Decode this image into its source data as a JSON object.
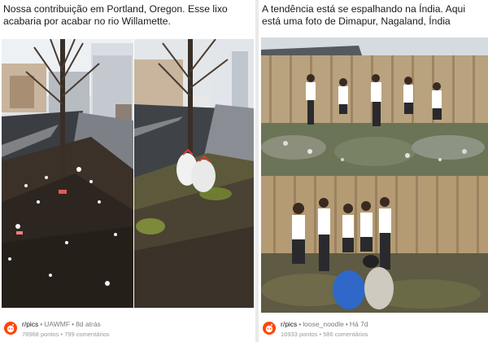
{
  "posts": [
    {
      "caption": "Nossa contribuição em Portland, Oregon. Esse lixo acabaria por acabar no rio Willamette.",
      "subreddit": "r/pics",
      "author": "UAWMF",
      "time": "8d atrás",
      "points": "78968 pontos",
      "comments": "799 comentários"
    },
    {
      "caption": "A tendência está se espalhando na Índia. Aqui está uma foto de Dimapur, Nagaland, Índia",
      "subreddit": "r/pics",
      "author": "loose_noodle",
      "time": "Há 7d",
      "points": "16933 pontos",
      "comments": "586 comentários"
    }
  ],
  "colors": {
    "reddit_orange": "#ff4500",
    "meta_gray": "#7c7c7c"
  },
  "icons": {
    "subreddit_logo": "reddit-alien-icon"
  }
}
